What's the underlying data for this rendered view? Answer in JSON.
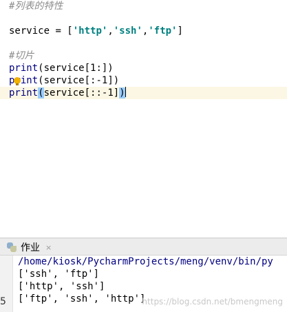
{
  "editor": {
    "comment_list_props": "#列表的特性",
    "service_var": "service",
    "service_assign": " = [",
    "service_items": [
      "'http'",
      "'ssh'",
      "'ftp'"
    ],
    "service_sep": ",",
    "service_close": "]",
    "comment_slice": "#切片",
    "print_kw": "print",
    "lines_slice": [
      {
        "open": "(service[",
        "arg": "1",
        "rest": ":])"
      },
      {
        "open": "(service[",
        "arg": ":-1",
        "rest": "])"
      },
      {
        "open": "service[",
        "arg": "::-1",
        "rest": "]"
      }
    ]
  },
  "run_panel": {
    "tab_label": "作业",
    "tab_close": "×",
    "output_lines": [
      "/home/kiosk/PycharmProjects/meng/venv/bin/py",
      "['ssh', 'ftp']",
      "['http', 'ssh']",
      "['ftp', 'ssh', 'http']"
    ],
    "gutter_digit": "5"
  },
  "watermark": "https://blog.csdn.net/bmengmeng",
  "colors": {
    "current_line_bg": "#fbf7e4",
    "string": "#008080",
    "comment": "#8c8c8c",
    "builtin": "#000080",
    "paren_highlight": "#99ccff"
  }
}
